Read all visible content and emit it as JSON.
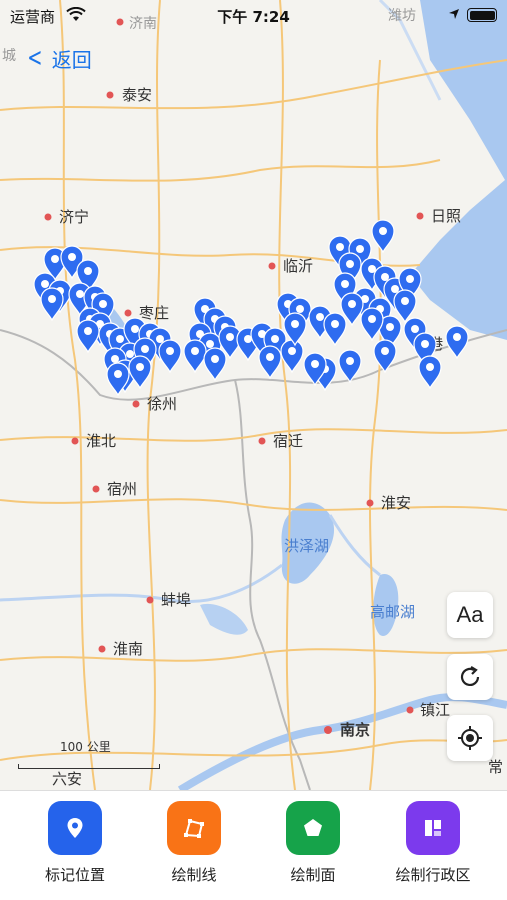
{
  "status_bar": {
    "carrier": "运营商",
    "time": "下午 7:24"
  },
  "nav": {
    "back_label": "返回"
  },
  "map": {
    "cities": [
      "济南",
      "泰安",
      "济宁",
      "枣庄",
      "临沂",
      "日照",
      "徐州",
      "淮北",
      "宿迁",
      "宿州",
      "淮安",
      "蚌埠",
      "淮南",
      "南京",
      "镇江",
      "潍坊",
      "城",
      "港",
      "六安",
      "常"
    ],
    "water_labels": [
      "洪泽湖",
      "高邮湖"
    ],
    "scale_label": "100 公里",
    "marker_color": "#2e6cf0"
  },
  "controls": {
    "font_size_label": "Aa"
  },
  "toolbar": [
    {
      "label": "标记位置",
      "color": "#2563eb",
      "icon": "location-pin-icon"
    },
    {
      "label": "绘制线",
      "color": "#f97316",
      "icon": "polyline-icon"
    },
    {
      "label": "绘制面",
      "color": "#16a34a",
      "icon": "pentagon-icon"
    },
    {
      "label": "绘制行政区",
      "color": "#7c3aed",
      "icon": "region-icon"
    }
  ]
}
